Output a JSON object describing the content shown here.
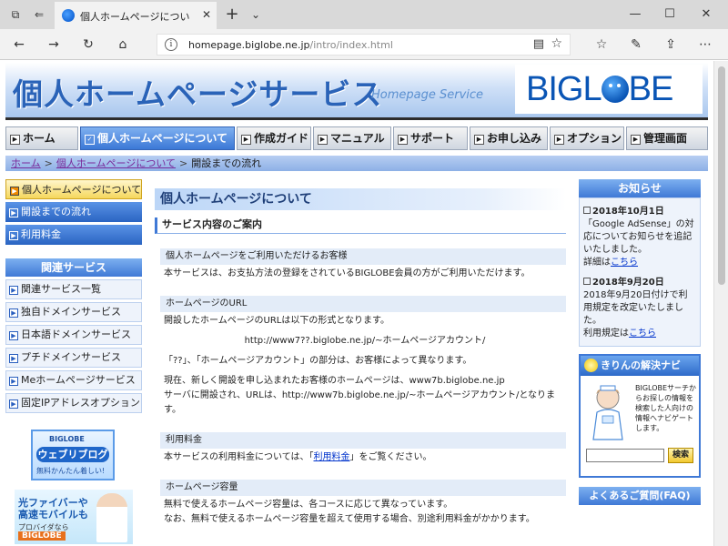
{
  "browser": {
    "tab_title": "個人ホームページについて：",
    "tab_close": "✕",
    "new_tab": "+",
    "tab_menu": "⌄",
    "url_host": "homepage.biglobe.ne.jp",
    "url_path": "/intro/index.html",
    "icons": [
      "tab-actions-icon",
      "back-tabs-icon",
      "back-icon",
      "forward-icon",
      "refresh-icon",
      "home-icon",
      "info-icon",
      "reading-view-icon",
      "favorite-star-icon",
      "favorites-icon",
      "pen-icon",
      "share-icon",
      "more-icon",
      "minimize-icon",
      "maximize-icon",
      "close-icon"
    ]
  },
  "header": {
    "title": "個人ホームページサービス",
    "subtitle": "Homepage Service",
    "logo_pre": "BIGL",
    "logo_post": "BE"
  },
  "gnav": [
    {
      "label": "ホーム",
      "active": false
    },
    {
      "label": "個人ホームページについて",
      "active": true
    },
    {
      "label": "作成ガイド",
      "active": false
    },
    {
      "label": "マニュアル",
      "active": false
    },
    {
      "label": "サポート",
      "active": false
    },
    {
      "label": "お申し込み",
      "active": false
    },
    {
      "label": "オプション",
      "active": false
    },
    {
      "label": "管理画面",
      "active": false
    }
  ],
  "breadcrumb": {
    "home": "ホーム",
    "sep": ">",
    "parent": "個人ホームページについて",
    "current": "開設までの流れ"
  },
  "left_menu": {
    "items": [
      {
        "label": "個人ホームページについて",
        "active": true
      },
      {
        "label": "開設までの流れ",
        "active": false
      },
      {
        "label": "利用料金",
        "active": false
      }
    ],
    "related_title": "関連サービス",
    "related": [
      "関連サービス一覧",
      "独自ドメインサービス",
      "日本語ドメインサービス",
      "プチドメインサービス",
      "Meホームページサービス",
      "固定IPアドレスオプション"
    ],
    "blog_banner": {
      "line1": "BIGLOBE",
      "line2": "ウェブリブログ",
      "line3": "無料かんたん着しい!"
    },
    "fiber_banner": {
      "line1": "光ファイバーや",
      "line2": "高速モバイルも",
      "line3": "プロバイダなら",
      "line4": "BIGLOBE"
    }
  },
  "main": {
    "title": "個人ホームページについて",
    "subtitle": "サービス内容のご案内",
    "sections": [
      {
        "head": "個人ホームページをご利用いただけるお客様",
        "body1": "本サービスは、お支払方法の登録をされているBIGLOBE会員の方がご利用いただけます。"
      },
      {
        "head": "ホームページのURL",
        "body1": "開設したホームページのURLは以下の形式となります。",
        "url": "http://www7??.biglobe.ne.jp/~ホームページアカウント/",
        "body2": "「??」、「ホームページアカウント」の部分は、お客様によって異なります。",
        "body3": "現在、新しく開設を申し込まれたお客様のホームページは、www7b.biglobe.ne.jp",
        "body4": "サーバに開設され、URLは、http://www7b.biglobe.ne.jp/~ホームページアカウント/となります。"
      },
      {
        "head": "利用料金",
        "body_pre": "本サービスの利用料金については、「",
        "link": "利用料金",
        "body_post": "」をご覧ください。"
      },
      {
        "head": "ホームページ容量",
        "body1": "無料で使えるホームページ容量は、各コースに応じて異なっています。",
        "body2": "なお、無料で使えるホームページ容量を超えて使用する場合、別途利用料金がかかります。"
      }
    ]
  },
  "right": {
    "news_title": "お知らせ",
    "news": [
      {
        "date": "2018年10月1日",
        "body": "「Google AdSense」の対応についてお知らせを追記いたしました。",
        "detail": "詳細は",
        "link": "こちら"
      },
      {
        "date": "2018年9月20日",
        "body": "2018年9月20日付けで利用規定を改定いたしました。",
        "detail": "利用規定は",
        "link": "こちら"
      }
    ],
    "help_title": "きりんの解決ナビ",
    "help_text": "BIGLOBEサーチからお探しの情報を検索した人向けの情報へナビゲートします。",
    "help_input_value": "",
    "help_button": "検索",
    "faq_title": "よくあるご質問(FAQ)"
  }
}
